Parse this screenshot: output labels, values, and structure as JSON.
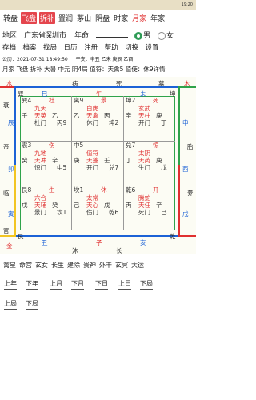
{
  "status": {
    "left": "转盘 飞盘 拆补",
    "clock": "19:20",
    "battery": "",
    "carrier": ""
  },
  "toolbar": {
    "items": [
      "转盘",
      "飞盘",
      "拆补",
      "置润",
      "茅山",
      "阴盘",
      "时家",
      "月家",
      "年家"
    ]
  },
  "location": {
    "label": "地区",
    "province": "广东省",
    "city": "深圳市",
    "year_label": "年命",
    "gender_male": "男",
    "gender_female": "女"
  },
  "menu": {
    "items": [
      "存档",
      "档案",
      "找局",
      "日历",
      "注册",
      "帮助",
      "切换",
      "设置"
    ]
  },
  "info": {
    "time": "公历：2021-07-31 18:49:50",
    "ganzhi": "干支：辛丑 乙未 庚辰 乙酉"
  },
  "summary": {
    "text": "月家 飞盘 拆补 大暑 中元 阴4局 值符：天禽5 值使：休9详情"
  },
  "board": {
    "top": [
      "巽",
      "巳",
      "病",
      "午",
      "死",
      "未",
      "墓",
      "坤"
    ],
    "top2": [
      "水",
      "",
      "午",
      "",
      "",
      "木"
    ],
    "left": [
      "衰",
      "辰",
      "卯",
      "寅",
      "丑",
      "帝",
      "临",
      "官"
    ],
    "right": [
      "申",
      "酉",
      "戌",
      "亥",
      "木",
      "胎",
      "养"
    ],
    "bottom": [
      "金",
      "艮",
      "丑",
      "沐",
      "癸",
      "子",
      "长",
      "乾",
      "壬",
      "亥"
    ],
    "cells": [
      {
        "n": "巽4",
        "gate": "杜",
        "star": "九天",
        "door": "天英",
        "stem1": "壬",
        "stem2": "乙",
        "god": "杜门",
        "num": "丙9"
      },
      {
        "n": "离9",
        "gate": "景",
        "star": "白虎",
        "door": "天禽",
        "stem1": "乙",
        "stem2": "丙",
        "god": "休门",
        "num": "坤2"
      },
      {
        "n": "坤2",
        "gate": "死",
        "star": "玄武",
        "door": "天柱",
        "stem1": "辛",
        "stem2": "庚",
        "god": "开门",
        "num": "丁"
      },
      {
        "n": "震3",
        "gate": "伤",
        "star": "九地",
        "door": "天冲",
        "stem1": "癸",
        "stem2": "辛",
        "god": "惊门",
        "num": "中5"
      },
      {
        "n": "中5",
        "gate": "",
        "star": "值符",
        "door": "天蓬",
        "stem1": "庚",
        "stem2": "壬",
        "god": "开门",
        "num": "兑7"
      },
      {
        "n": "兑7",
        "gate": "惊",
        "star": "太阴",
        "door": "天芮",
        "stem1": "丁",
        "stem2": "庚",
        "god": "生门",
        "num": "戊"
      },
      {
        "n": "艮8",
        "gate": "生",
        "star": "六合",
        "door": "天辅",
        "stem1": "戊",
        "stem2": "癸",
        "god": "景门",
        "num": "坎1"
      },
      {
        "n": "坎1",
        "gate": "休",
        "star": "太常",
        "door": "天心",
        "stem1": "己",
        "stem2": "戊",
        "god": "伤门",
        "num": "乾6"
      },
      {
        "n": "乾6",
        "gate": "开",
        "star": "腾蛇",
        "door": "天任",
        "stem1": "丙",
        "stem2": "辛",
        "god": "死门",
        "num": "己"
      }
    ]
  },
  "tabs": {
    "row1": [
      "禽星",
      "命宫",
      "玄女",
      "长生",
      "建除",
      "贵神",
      "外干",
      "玄冥",
      "大运"
    ]
  },
  "buttons": {
    "row1": [
      "上年",
      "下年",
      "上月",
      "下月",
      "下日",
      "上日",
      "下局"
    ],
    "row2": [
      "上局",
      "下局"
    ]
  }
}
